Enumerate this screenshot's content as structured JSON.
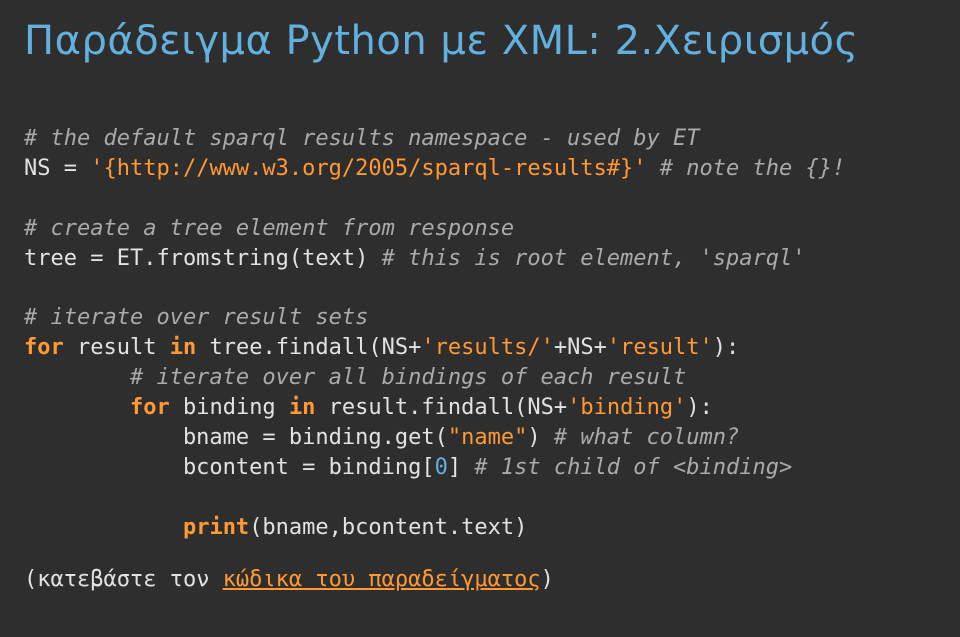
{
  "title": "Παράδειγμα Python με XML: 2.Χειρισμός",
  "code": {
    "c1": "# the default sparql results namespace - used by ET",
    "ns_lhs": "NS = ",
    "ns_val": "'{http://www.w3.org/2005/sparql-results#}'",
    "ns_note": " # note the {}!",
    "c2": "# create a tree element from response",
    "tree_lhs": "tree = ET.fromstring(text) ",
    "tree_note": "# this is root element, 'sparql'",
    "c3": "# iterate over result sets",
    "for1_for": "for",
    "for1_mid": " result ",
    "for1_in": "in",
    "for1_tail": " tree.findall(NS+",
    "for1_s1": "'results/'",
    "for1_plus": "+NS+",
    "for1_s2": "'result'",
    "for1_end": "):",
    "c4": "        # iterate over all bindings of each result",
    "for2_indent": "        ",
    "for2_for": "for",
    "for2_mid": " binding ",
    "for2_in": "in",
    "for2_tail": " result.findall(NS+",
    "for2_s": "'binding'",
    "for2_end": "):",
    "bname_indent": "            bname = binding.get(",
    "bname_s": "\"name\"",
    "bname_close": ") ",
    "bname_note": "# what column?",
    "bcont_indent": "            bcontent = binding[",
    "bcont_n": "0",
    "bcont_close": "] ",
    "bcont_note": "# 1st child of <binding>",
    "print_indent": "            ",
    "print_kw": "print",
    "print_args": "(bname,bcontent.text)"
  },
  "footer": {
    "open": "(",
    "text_before": "κατεβάστε τον ",
    "link": "κώδικα του παραδείγματος",
    "close": ")"
  }
}
